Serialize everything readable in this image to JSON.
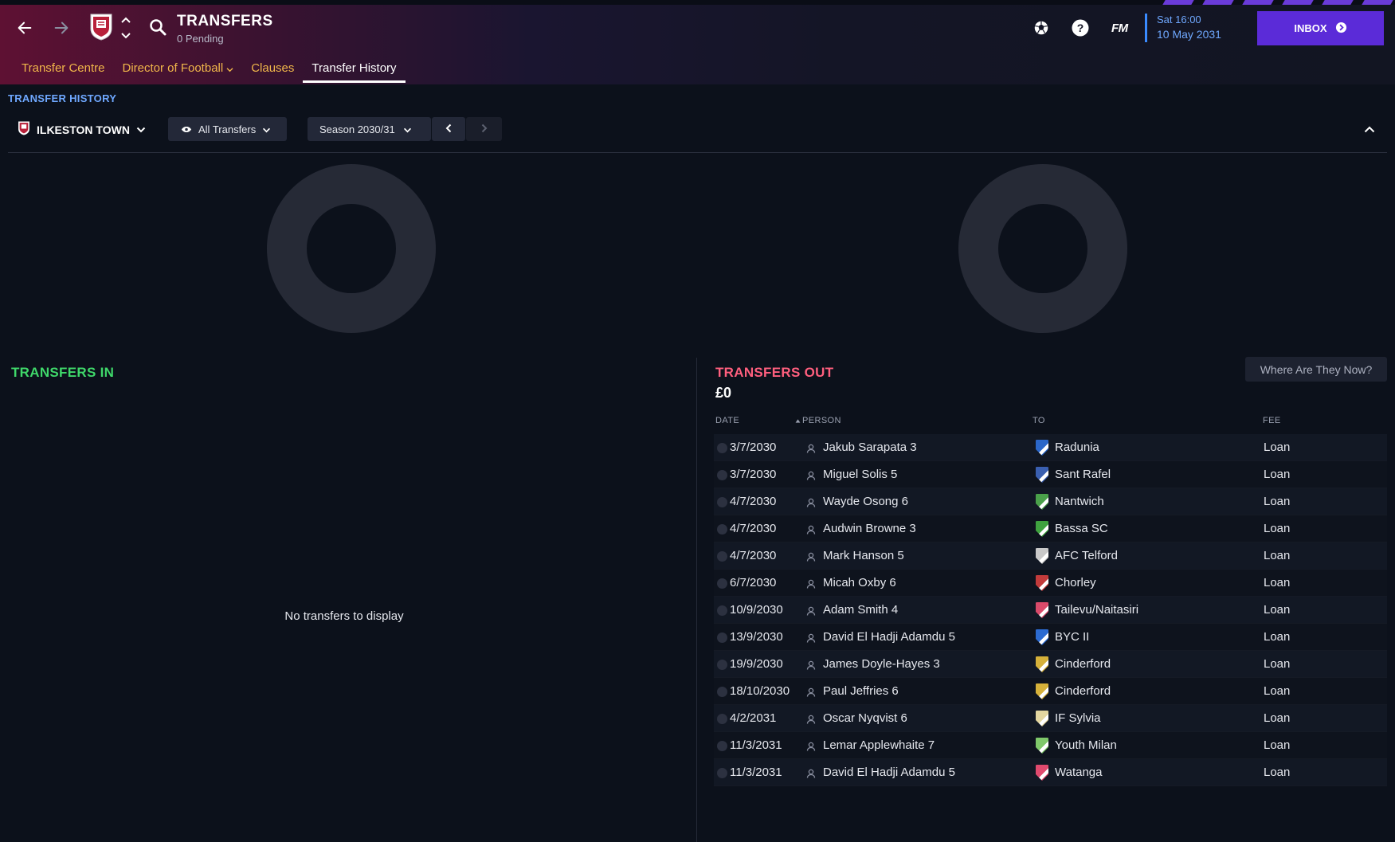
{
  "header": {
    "title": "TRANSFERS",
    "subtitle": "0 Pending",
    "fm_logo": "FM",
    "time": "Sat 16:00",
    "date": "10 May 2031",
    "inbox_label": "INBOX"
  },
  "tabs": [
    {
      "label": "Transfer Centre"
    },
    {
      "label": "Director of Football"
    },
    {
      "label": "Clauses"
    },
    {
      "label": "Transfer History"
    }
  ],
  "section_label": "TRANSFER HISTORY",
  "club": {
    "name": "ILKESTON TOWN"
  },
  "filters": {
    "view": "All Transfers",
    "season": "Season 2030/31"
  },
  "transfers_in": {
    "title": "TRANSFERS IN",
    "empty_message": "No transfers to display"
  },
  "transfers_out": {
    "title": "TRANSFERS OUT",
    "total": "£0",
    "where_button": "Where Are They Now?",
    "columns": {
      "date": "DATE",
      "person": "PERSON",
      "to": "TO",
      "fee": "FEE"
    },
    "rows": [
      {
        "date": "3/7/2030",
        "person": "Jakub Sarapata 3",
        "to": "Radunia",
        "fee": "Loan",
        "badge_color": "#2b67c9"
      },
      {
        "date": "3/7/2030",
        "person": "Miguel Solis 5",
        "to": "Sant Rafel",
        "fee": "Loan",
        "badge_color": "#3a5fb0"
      },
      {
        "date": "4/7/2030",
        "person": "Wayde Osong 6",
        "to": "Nantwich",
        "fee": "Loan",
        "badge_color": "#4aa04a"
      },
      {
        "date": "4/7/2030",
        "person": "Audwin Browne 3",
        "to": "Bassa SC",
        "fee": "Loan",
        "badge_color": "#3fa23f"
      },
      {
        "date": "4/7/2030",
        "person": "Mark Hanson 5",
        "to": "AFC Telford",
        "fee": "Loan",
        "badge_color": "#c9c9c9"
      },
      {
        "date": "6/7/2030",
        "person": "Micah Oxby 6",
        "to": "Chorley",
        "fee": "Loan",
        "badge_color": "#c23b3b"
      },
      {
        "date": "10/9/2030",
        "person": "Adam Smith 4",
        "to": "Tailevu/Naitasiri",
        "fee": "Loan",
        "badge_color": "#d94a6a"
      },
      {
        "date": "13/9/2030",
        "person": "David El Hadji Adamdu 5",
        "to": "BYC II",
        "fee": "Loan",
        "badge_color": "#2c6bd1"
      },
      {
        "date": "19/9/2030",
        "person": "James Doyle-Hayes 3",
        "to": "Cinderford",
        "fee": "Loan",
        "badge_color": "#d6b13a"
      },
      {
        "date": "18/10/2030",
        "person": "Paul Jeffries 6",
        "to": "Cinderford",
        "fee": "Loan",
        "badge_color": "#d6b13a"
      },
      {
        "date": "4/2/2031",
        "person": "Oscar Nyqvist 6",
        "to": "IF Sylvia",
        "fee": "Loan",
        "badge_color": "#e3d6a0"
      },
      {
        "date": "11/3/2031",
        "person": "Lemar Applewhaite 7",
        "to": "Youth Milan",
        "fee": "Loan",
        "badge_color": "#7fc86a"
      },
      {
        "date": "11/3/2031",
        "person": "David El Hadji Adamdu 5",
        "to": "Watanga",
        "fee": "Loan",
        "badge_color": "#e04a6e"
      }
    ]
  },
  "colors": {
    "accent_purple": "#5b2bd8",
    "tab_gold": "#f0b64a",
    "in_green": "#3fd86a",
    "out_pink": "#ff5f7e",
    "date_blue": "#6fa8ff"
  }
}
